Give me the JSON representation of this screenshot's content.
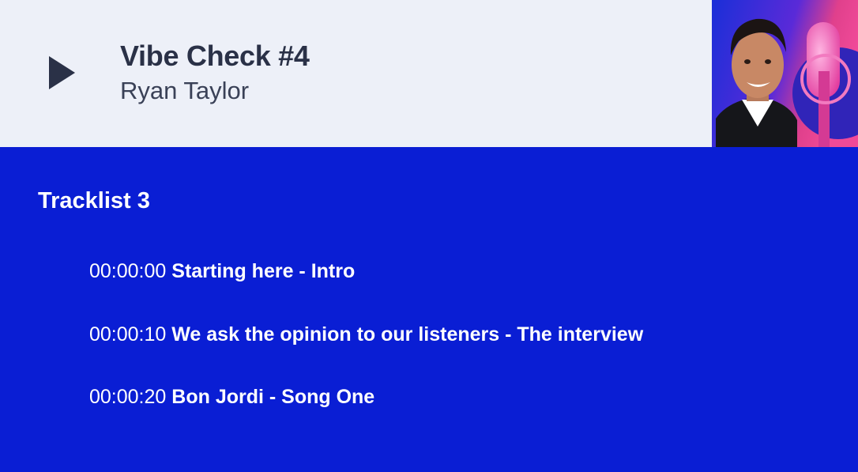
{
  "header": {
    "title": "Vibe Check #4",
    "artist": "Ryan Taylor",
    "play_icon": "play-icon",
    "cover_art": "podcast-host-with-microphone"
  },
  "tracklist": {
    "heading": "Tracklist 3",
    "tracks": [
      {
        "time": "00:00:00",
        "name": "Starting here - Intro"
      },
      {
        "time": "00:00:10",
        "name": "We ask the opinion to our listeners - The interview"
      },
      {
        "time": "00:00:20",
        "name": "Bon Jordi - Song One"
      }
    ]
  },
  "colors": {
    "header_bg": "#edf0f8",
    "body_bg": "#0a1ed4",
    "title_text": "#2a3147",
    "play_icon": "#2a3147",
    "track_text": "#ffffff"
  }
}
